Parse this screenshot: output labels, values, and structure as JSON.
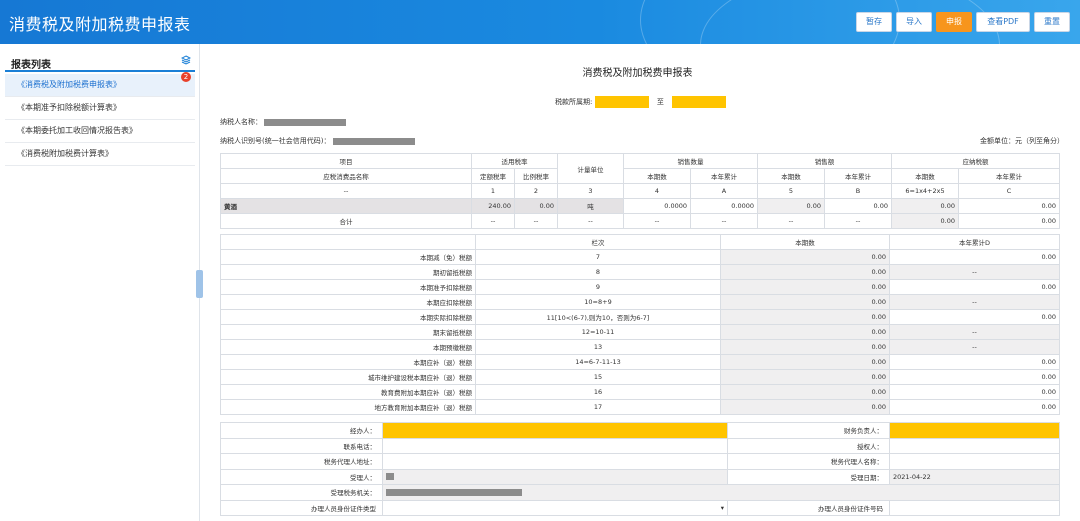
{
  "header": {
    "title": "消费税及附加税费申报表",
    "buttons": [
      "暂存",
      "导入",
      "申报",
      "查看PDF",
      "重置"
    ]
  },
  "sidebar": {
    "title": "报表列表",
    "badge": "2",
    "items": [
      "《消费税及附加税费申报表》",
      "《本期准予扣除税额计算表》",
      "《本期委托加工收回情况报告表》",
      "《消费税附加税费计算表》"
    ]
  },
  "doc": {
    "title": "消费税及附加税费申报表",
    "period_label": "税款所属期:",
    "period_to": "至",
    "taxpayer_name_label": "纳税人名称：",
    "taxpayer_id_label": "纳税人识别号(统一社会信用代码)：",
    "amount_unit": "金额单位：元（列至角分）"
  },
  "table1": {
    "h_item": "项目",
    "h_rate": "适用税率",
    "h_unit": "计量单位",
    "h_qty": "销售数量",
    "h_sales": "销售额",
    "h_tax": "应纳税额",
    "h_taxitem": "应税消费品名称",
    "h_fixed": "定额税率",
    "h_ratio": "比例税率",
    "h_cur": "本期数",
    "h_ytd": "本年累计",
    "idx": [
      "--",
      "1",
      "2",
      "3",
      "4",
      "A",
      "5",
      "B",
      "6=1x4+2x5",
      "C"
    ],
    "row1": [
      "黄酒",
      "240.00",
      "0.00",
      "吨",
      "0.0000",
      "0.0000",
      "0.00",
      "0.00",
      "0.00",
      "0.00"
    ],
    "total": [
      "合计",
      "--",
      "--",
      "--",
      "--",
      "--",
      "--",
      "--",
      "0.00",
      "0.00"
    ]
  },
  "table2": {
    "h_col": "栏次",
    "h_cur": "本期数",
    "h_ytd": "本年累计D",
    "rows": [
      {
        "label": "本期减（免）税额",
        "idx": "7",
        "cur": "0.00",
        "ytd": "0.00"
      },
      {
        "label": "期初留抵税额",
        "idx": "8",
        "cur": "0.00",
        "ytd": "--"
      },
      {
        "label": "本期准予扣除税额",
        "idx": "9",
        "cur": "0.00",
        "ytd": "0.00"
      },
      {
        "label": "本期应扣除税额",
        "idx": "10=8+9",
        "cur": "0.00",
        "ytd": "--"
      },
      {
        "label": "本期实际扣除税额",
        "idx": "11[10<(6-7),则为10，否则为6-7]",
        "cur": "0.00",
        "ytd": "0.00"
      },
      {
        "label": "期末留抵税额",
        "idx": "12=10-11",
        "cur": "0.00",
        "ytd": "--"
      },
      {
        "label": "本期预缴税额",
        "idx": "13",
        "cur": "0.00",
        "ytd": "--"
      },
      {
        "label": "本期应补（退）税额",
        "idx": "14=6-7-11-13",
        "cur": "0.00",
        "ytd": "0.00"
      },
      {
        "label": "城市维护建设税本期应补（退）税额",
        "idx": "15",
        "cur": "0.00",
        "ytd": "0.00"
      },
      {
        "label": "教育费附加本期应补（退）税额",
        "idx": "16",
        "cur": "0.00",
        "ytd": "0.00"
      },
      {
        "label": "地方教育附加本期应补（退）税额",
        "idx": "17",
        "cur": "0.00",
        "ytd": "0.00"
      }
    ]
  },
  "table3": {
    "operator": "经办人：",
    "finance": "财务负责人：",
    "phone": "联系电话：",
    "authorized": "授权人：",
    "agent_addr": "税务代理人地址：",
    "agent_name": "税务代理人名称：",
    "acceptor": "受理人：",
    "accept_date": "受理日期：",
    "accept_date_val": "2021-04-22",
    "tax_office": "受理税务机关：",
    "id_type": "办理人员身份证件类型",
    "id_no": "办理人员身份证件号码"
  }
}
